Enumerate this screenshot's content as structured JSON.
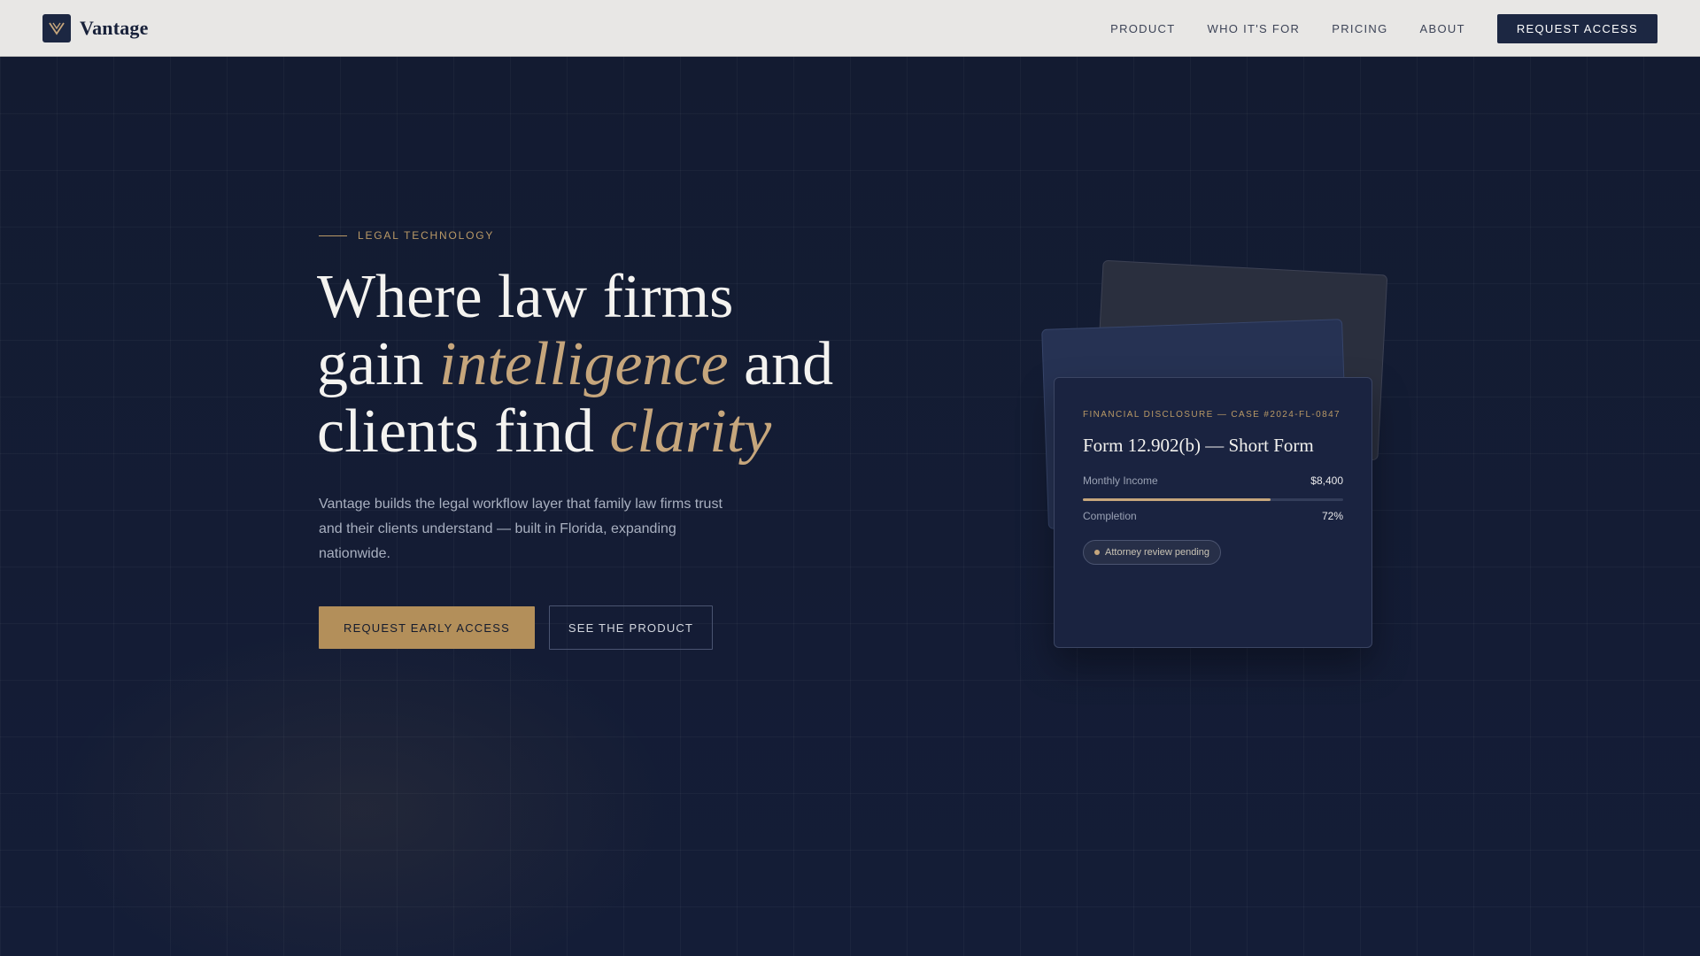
{
  "brand": {
    "name": "Vantage",
    "logo_icon": "v-monogram-icon",
    "accent": "#c6a67c",
    "navy": "#1c2742"
  },
  "nav": {
    "links": [
      "PRODUCT",
      "WHO IT'S FOR",
      "PRICING",
      "ABOUT"
    ],
    "cta_label": "REQUEST ACCESS"
  },
  "hero": {
    "eyebrow": "LEGAL TECHNOLOGY",
    "headline": {
      "line1": "Where law firms",
      "line2_pre": "gain ",
      "line2_accent": "intelligence",
      "line2_post": " and",
      "line3_pre": "clients find ",
      "line3_accent": "clarity"
    },
    "subtext": "Vantage builds the legal workflow layer that family law firms trust and their clients understand — built in Florida, expanding nationwide.",
    "primary_cta": "REQUEST EARLY ACCESS",
    "secondary_cta": "SEE THE PRODUCT"
  },
  "card": {
    "eyebrow": "FINANCIAL DISCLOSURE — CASE #2024-FL-0847",
    "title": "Form 12.902(b) — Short Form",
    "income_label": "Monthly Income",
    "income_value": "$8,400",
    "completion_label": "Completion",
    "completion_value": "72%",
    "completion_fraction": 0.72,
    "status_badge": "Attorney review pending"
  }
}
